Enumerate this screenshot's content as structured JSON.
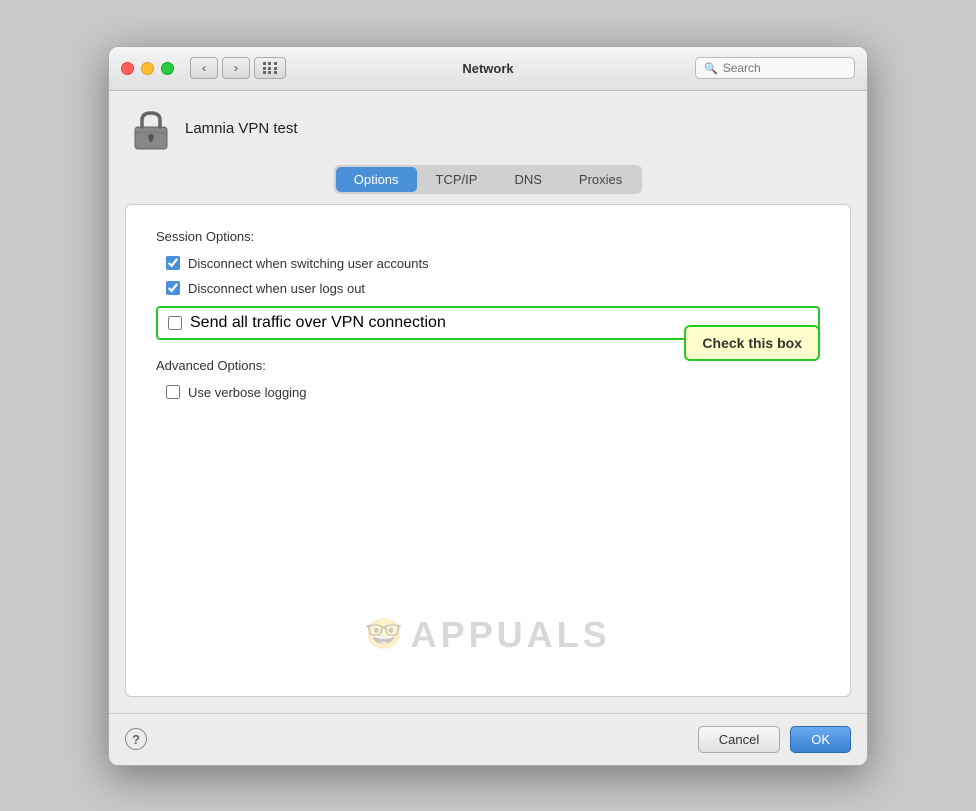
{
  "titlebar": {
    "title": "Network",
    "search_placeholder": "Search"
  },
  "vpn": {
    "name": "Lamnia VPN test"
  },
  "tabs": [
    {
      "label": "Options",
      "active": true
    },
    {
      "label": "TCP/IP",
      "active": false
    },
    {
      "label": "DNS",
      "active": false
    },
    {
      "label": "Proxies",
      "active": false
    }
  ],
  "session_options": {
    "title": "Session Options:",
    "items": [
      {
        "label": "Disconnect when switching user accounts",
        "checked": true
      },
      {
        "label": "Disconnect when user logs out",
        "checked": true
      },
      {
        "label": "Send all traffic over VPN connection",
        "checked": false,
        "highlighted": true
      }
    ]
  },
  "advanced_options": {
    "title": "Advanced Options:",
    "items": [
      {
        "label": "Use verbose logging",
        "checked": false
      }
    ]
  },
  "tooltip": {
    "text": "Check this box"
  },
  "buttons": {
    "help": "?",
    "cancel": "Cancel",
    "ok": "OK"
  }
}
